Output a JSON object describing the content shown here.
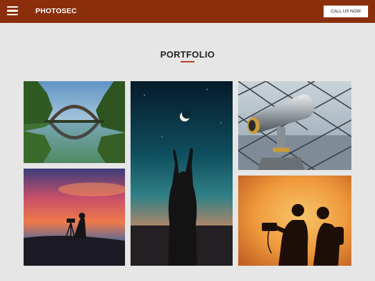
{
  "header": {
    "brand": "PHOTOSEC",
    "cta_label": "CALL US NOW",
    "menu_icon": "hamburger-menu-icon",
    "background_color": "#8a2e0b"
  },
  "main": {
    "section_title": "PORTFOLIO",
    "accent_color": "#b3431c",
    "photos": [
      {
        "subject": "stone arch bridge reflected in a forest lake"
      },
      {
        "subject": "silhouette of a person reaching up toward a crescent moon"
      },
      {
        "subject": "coin-operated binoculars overlooking a city"
      },
      {
        "subject": "photographer silhouette with tripod at sunset"
      },
      {
        "subject": "two photographers silhouetted against an orange sky"
      }
    ]
  }
}
